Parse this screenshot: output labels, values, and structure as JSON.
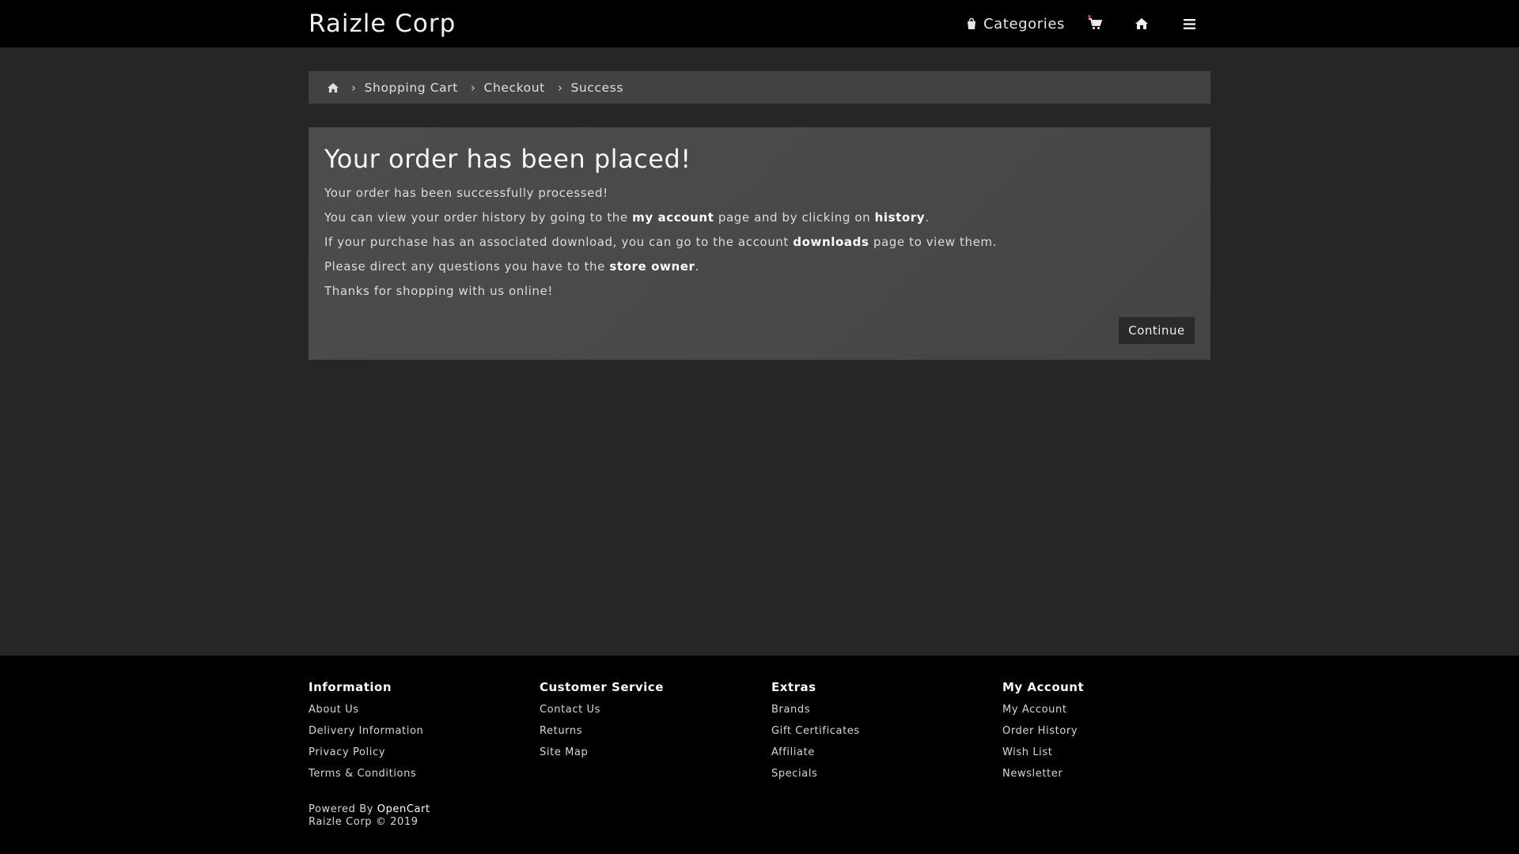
{
  "header": {
    "brand": "Raizle Corp",
    "categories_label": "Categories",
    "icons": [
      "shopping-bag-icon",
      "shopping-cart-icon",
      "home-icon",
      "menu-icon"
    ],
    "cart_dot_color": "#e02424"
  },
  "breadcrumb": {
    "items": [
      "Shopping Cart",
      "Checkout",
      "Success"
    ]
  },
  "main": {
    "title": "Your order has been placed!",
    "line1": "Your order has been successfully processed!",
    "line2": {
      "before": "You can view your order history by going to the ",
      "link1": "my account",
      "middle": " page and by clicking on ",
      "link2": "history",
      "after": "."
    },
    "line3": {
      "before": "If your purchase has an associated download, you can go to the account ",
      "link": "downloads",
      "after": " page to view them."
    },
    "line4": {
      "before": "Please direct any questions you have to the ",
      "link": "store owner",
      "after": "."
    },
    "line5": "Thanks for shopping with us online!",
    "continue_label": "Continue"
  },
  "footer": {
    "columns": [
      {
        "title": "Information",
        "items": [
          "About Us",
          "Delivery Information",
          "Privacy Policy",
          "Terms & Conditions"
        ]
      },
      {
        "title": "Customer Service",
        "items": [
          "Contact Us",
          "Returns",
          "Site Map"
        ]
      },
      {
        "title": "Extras",
        "items": [
          "Brands",
          "Gift Certificates",
          "Affiliate",
          "Specials"
        ]
      },
      {
        "title": "My Account",
        "items": [
          "My Account",
          "Order History",
          "Wish List",
          "Newsletter"
        ]
      }
    ],
    "powered_prefix": "Powered By",
    "powered_link": "OpenCart",
    "copyright": "Raizle Corp © 2019"
  },
  "colors": {
    "page_bg": "#262626",
    "bar_bg": "#000000",
    "panel_bg": "#4a4a4a",
    "breadcrumb_bg": "#424242"
  }
}
